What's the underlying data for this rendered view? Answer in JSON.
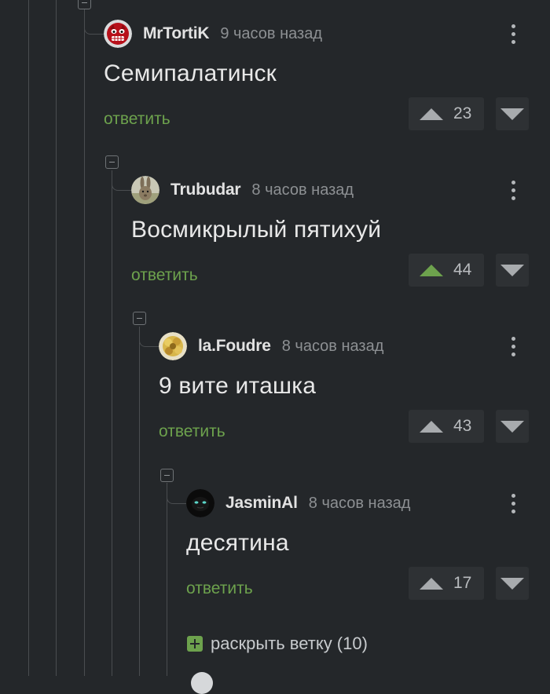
{
  "comments": [
    {
      "username": "MrTortiK",
      "time": "9 часов назад",
      "text": "Семипалатинск",
      "reply_label": "ответить",
      "score": "23",
      "upvoted": false,
      "avatar_icon": "red-monster-avatar-icon"
    },
    {
      "username": "Trubudar",
      "time": "8 часов назад",
      "text": "Восмикрылый пятихуй",
      "reply_label": "ответить",
      "score": "44",
      "upvoted": true,
      "avatar_icon": "rabbit-photo-avatar-icon"
    },
    {
      "username": "la.Foudre",
      "time": "8 часов назад",
      "text": "9 вите иташка",
      "reply_label": "ответить",
      "score": "43",
      "upvoted": false,
      "avatar_icon": "yellow-flower-avatar-icon"
    },
    {
      "username": "JasminAl",
      "time": "8 часов назад",
      "text": "десятина",
      "reply_label": "ответить",
      "score": "17",
      "upvoted": false,
      "avatar_icon": "dark-cat-face-avatar-icon"
    }
  ],
  "expand_branch": {
    "label": "раскрыть ветку (10)"
  },
  "colors": {
    "background": "#24272a",
    "accent_green": "#6da24d",
    "thread_line": "#4a4d50",
    "vote_bg": "#2e3134"
  }
}
